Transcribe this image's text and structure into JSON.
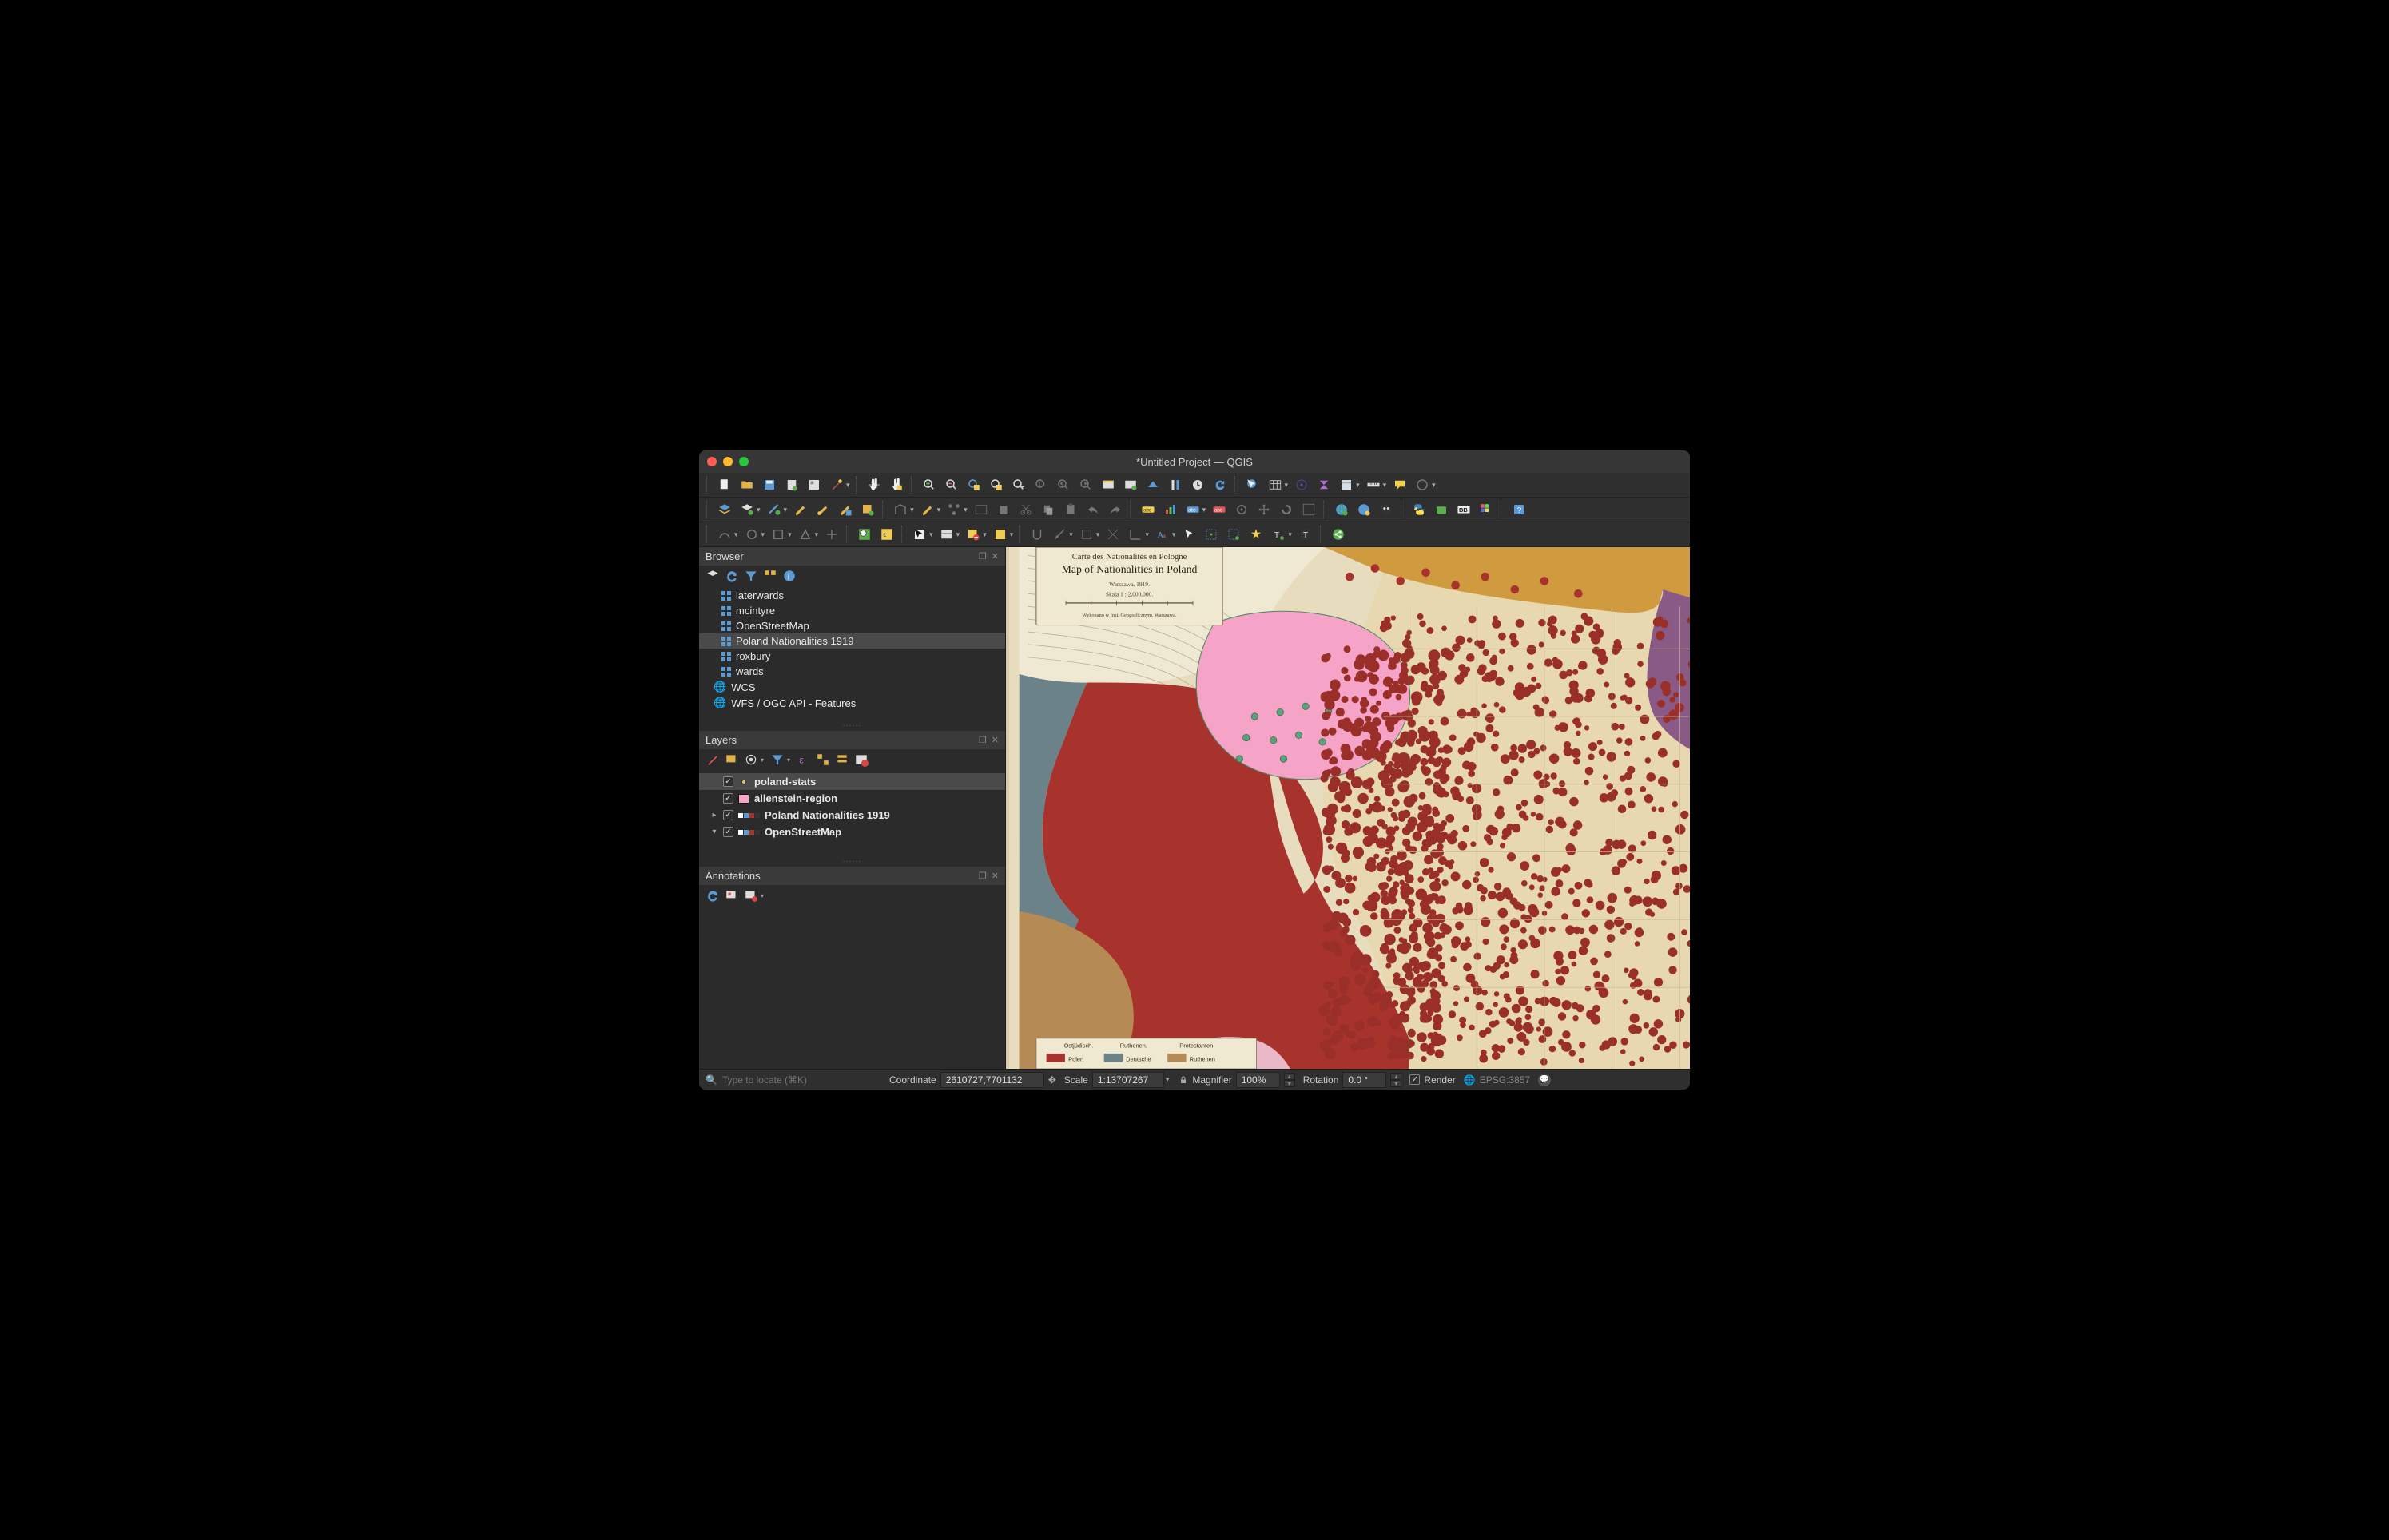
{
  "window": {
    "title": "*Untitled Project — QGIS"
  },
  "browser": {
    "title": "Browser",
    "items": [
      {
        "label": "laterwards",
        "icon": "grid"
      },
      {
        "label": "mcintyre",
        "icon": "grid"
      },
      {
        "label": "OpenStreetMap",
        "icon": "grid"
      },
      {
        "label": "Poland Nationalities 1919",
        "icon": "grid",
        "selected": true
      },
      {
        "label": "roxbury",
        "icon": "grid"
      },
      {
        "label": "wards",
        "icon": "grid"
      },
      {
        "label": "WCS",
        "icon": "globe",
        "indent": 1
      },
      {
        "label": "WFS / OGC API - Features",
        "icon": "globe",
        "indent": 1
      }
    ]
  },
  "layers": {
    "title": "Layers",
    "items": [
      {
        "label": "poland-stats",
        "type": "point",
        "checked": true,
        "selected": true,
        "bold": true
      },
      {
        "label": "allenstein-region",
        "type": "polygon",
        "checked": true,
        "bold": true,
        "swatch": "#f5a3c7"
      },
      {
        "label": "Poland Nationalities 1919",
        "type": "raster",
        "checked": true,
        "bold": true,
        "expandable": true
      },
      {
        "label": "OpenStreetMap",
        "type": "raster",
        "checked": true,
        "bold": true,
        "expandable": true,
        "expanded": true
      }
    ]
  },
  "annotations": {
    "title": "Annotations"
  },
  "map": {
    "cartouche_line1": "Carte des Nationalités en Pologne",
    "cartouche_line2": "Map of Nationalities in Poland",
    "cartouche_small_city": "Warszawa, 1919.",
    "cartouche_small_scale": "Skala 1 : 2,000,000.",
    "cartouche_publisher": "Wykonano w Inst. Geograficznym, Warszawa.",
    "legend_header1": "Ostjüdisch.",
    "legend_header2": "Ruthenen.",
    "legend_header3": "Protestanten.",
    "legend_item1": "Polen",
    "legend_item2": "Deutsche",
    "legend_item3": "Ruthenen"
  },
  "status": {
    "locate_placeholder": "Type to locate (⌘K)",
    "coord_label": "Coordinate",
    "coord_value": "2610727,7701132",
    "scale_label": "Scale",
    "scale_value": "1:13707267",
    "mag_label": "Magnifier",
    "mag_value": "100%",
    "rot_label": "Rotation",
    "rot_value": "0.0 °",
    "render_label": "Render",
    "crs": "EPSG:3857"
  }
}
